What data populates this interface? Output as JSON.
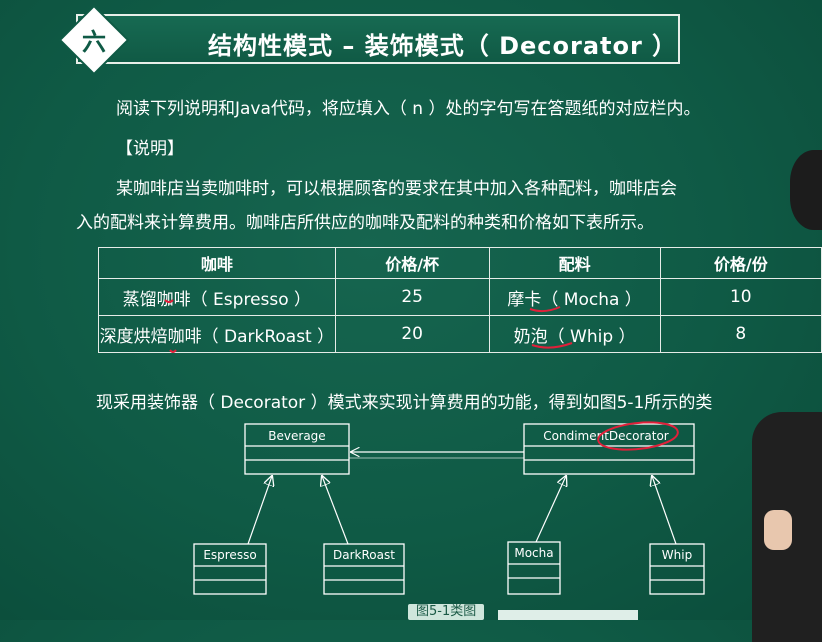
{
  "header": {
    "section_number": "六",
    "title": "结构性模式 – 装饰模式（ Decorator ）"
  },
  "intro": {
    "line1": "阅读下列说明和Java代码，将应填入（ n ）处的字句写在答题纸的对应栏内。",
    "heading": "【说明】",
    "line2": "某咖啡店当卖咖啡时，可以根据顾客的要求在其中加入各种配料，咖啡店会",
    "line3": "入的配料来计算费用。咖啡店所供应的咖啡及配料的种类和价格如下表所示。"
  },
  "price_table": {
    "headers": [
      "咖啡",
      "价格/杯",
      "配料",
      "价格/份"
    ],
    "rows": [
      [
        "蒸馏咖啡（ Espresso ）",
        "25",
        "摩卡（ Mocha ）",
        "10"
      ],
      [
        "深度烘焙咖啡（ DarkRoast ）",
        "20",
        "奶泡（ Whip ）",
        "8"
      ]
    ]
  },
  "diagram_intro": "现采用装饰器（ Decorator ）模式来实现计算费用的功能，得到如图5-1所示的类",
  "uml": {
    "beverage": "Beverage",
    "condiment_decorator": "CondimentDecorator",
    "espresso": "Espresso",
    "darkroast": "DarkRoast",
    "mocha": "Mocha",
    "whip": "Whip"
  },
  "caption": "图5-1类图",
  "colors": {
    "background": "#0f5a45",
    "text": "#ffffff",
    "annotation": "#e0203a"
  }
}
